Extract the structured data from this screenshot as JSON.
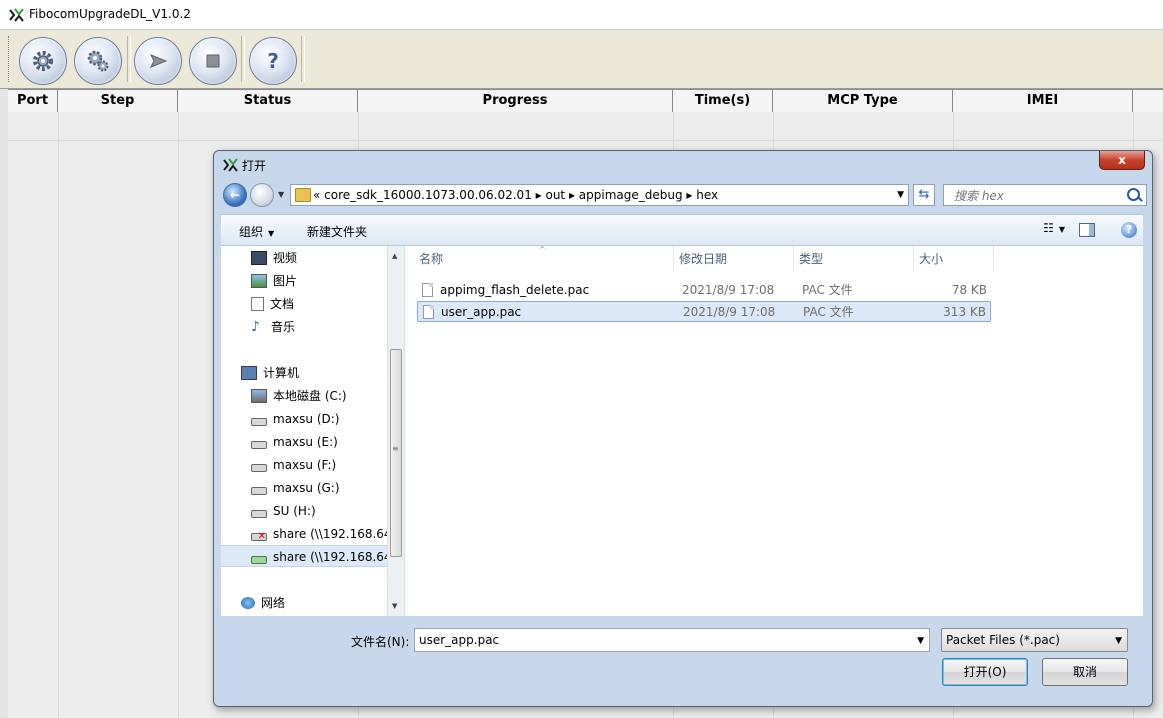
{
  "app": {
    "title": "FibocomUpgradeDL_V1.0.2",
    "toolbar_icons": [
      "settings-icon",
      "advanced-settings-icon",
      "play-icon",
      "stop-icon",
      "help-icon"
    ]
  },
  "grid": {
    "columns": [
      "Port",
      "Step",
      "Status",
      "Progress",
      "Time(s)",
      "MCP Type",
      "IMEI"
    ]
  },
  "dialog": {
    "title": "打开",
    "close_label": "x",
    "breadcrumbs": "«   core_sdk_16000.1073.00.06.02.01   ▸   out   ▸   appimage_debug   ▸   hex",
    "search_placeholder": "搜索 hex",
    "organize_label": "组织",
    "new_folder_label": "新建文件夹",
    "nav_items": [
      {
        "label": "视频",
        "icon": "video-icon"
      },
      {
        "label": "图片",
        "icon": "picture-icon"
      },
      {
        "label": "文档",
        "icon": "document-icon"
      },
      {
        "label": "音乐",
        "icon": "music-icon"
      },
      {
        "label": "计算机",
        "icon": "computer-icon"
      },
      {
        "label": "本地磁盘 (C:)",
        "icon": "local-disk-icon"
      },
      {
        "label": "maxsu (D:)",
        "icon": "drive-icon"
      },
      {
        "label": "maxsu (E:)",
        "icon": "drive-icon"
      },
      {
        "label": "maxsu (F:)",
        "icon": "drive-icon"
      },
      {
        "label": "maxsu (G:)",
        "icon": "drive-icon"
      },
      {
        "label": "SU (H:)",
        "icon": "drive-icon"
      },
      {
        "label": "share (\\\\192.168.64.",
        "icon": "network-drive-disconnected-icon"
      },
      {
        "label": "share (\\\\192.168.64.",
        "icon": "network-drive-icon"
      },
      {
        "label": "网络",
        "icon": "network-icon"
      }
    ],
    "file_headers": {
      "name": "名称",
      "date": "修改日期",
      "type": "类型",
      "size": "大小"
    },
    "files": [
      {
        "name": "appimg_flash_delete.pac",
        "date": "2021/8/9 17:08",
        "type": "PAC 文件",
        "size": "78 KB"
      },
      {
        "name": "user_app.pac",
        "date": "2021/8/9 17:08",
        "type": "PAC 文件",
        "size": "313 KB"
      }
    ],
    "filename_label": "文件名(N):",
    "filename_value": "user_app.pac",
    "filetype_value": "Packet Files (*.pac)",
    "open_label": "打开(O)",
    "cancel_label": "取消"
  },
  "colors": {
    "accent": "#3c7fb1",
    "selection": "#dbe8f8",
    "close": "#c7432e"
  }
}
